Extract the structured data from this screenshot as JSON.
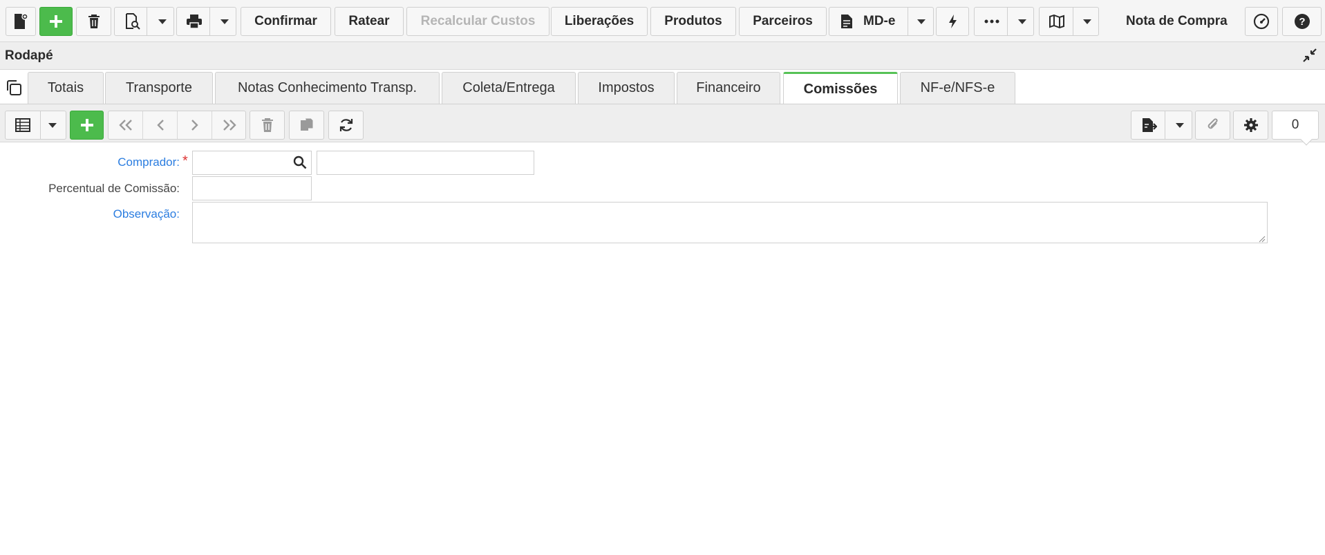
{
  "toolbar": {
    "confirmar": "Confirmar",
    "ratear": "Ratear",
    "recalcular": "Recalcular Custos",
    "liberacoes": "Liberações",
    "produtos": "Produtos",
    "parceiros": "Parceiros",
    "mde": "MD-e",
    "screen_title": "Nota de Compra"
  },
  "section": {
    "title": "Rodapé"
  },
  "tabs": [
    {
      "label": "Totais"
    },
    {
      "label": "Transporte"
    },
    {
      "label": "Notas Conhecimento Transp."
    },
    {
      "label": "Coleta/Entrega"
    },
    {
      "label": "Impostos"
    },
    {
      "label": "Financeiro"
    },
    {
      "label": "Comissões"
    },
    {
      "label": "NF-e/NFS-e"
    }
  ],
  "active_tab": "Comissões",
  "grid_toolbar": {
    "record_count": "0"
  },
  "form": {
    "comprador_label": "Comprador:",
    "comprador_value": "",
    "comprador_desc": "",
    "percentual_label": "Percentual de Comissão:",
    "percentual_value": "",
    "observacao_label": "Observação:",
    "observacao_value": ""
  },
  "colors": {
    "accent_green": "#4cbb4c",
    "link_blue": "#2b7de0",
    "required_red": "#d33333"
  }
}
